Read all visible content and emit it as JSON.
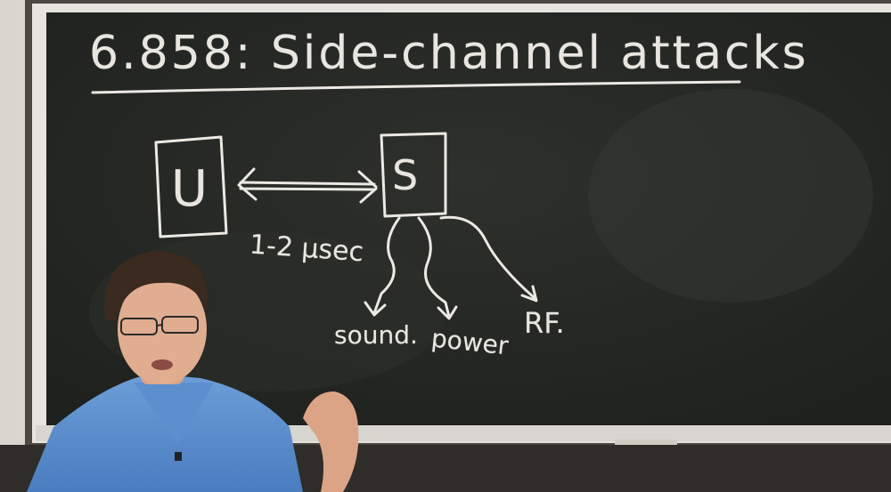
{
  "title": "6.858: Side-channel attacks",
  "diagram": {
    "user_node": "U",
    "server_node": "S",
    "latency": "1-2 μsec",
    "channels": [
      "sound.",
      "power",
      "RF."
    ]
  }
}
